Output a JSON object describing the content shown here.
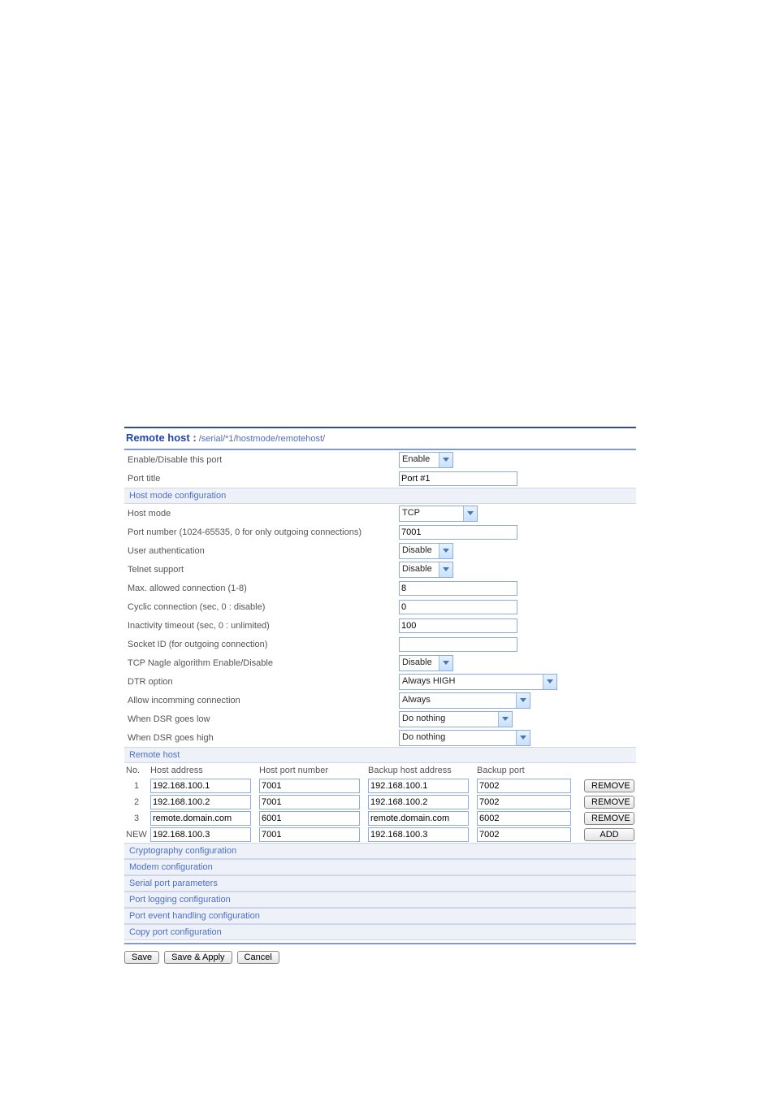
{
  "title": "Remote host :",
  "path_prefix": " /",
  "path_parts": [
    "serial",
    "*1",
    "hostmode",
    "remotehost"
  ],
  "path_suffix": "/",
  "rows": {
    "enable_lbl": "Enable/Disable this port",
    "enable_val": "Enable",
    "porttitle_lbl": "Port title",
    "porttitle_val": "Port #1"
  },
  "sec1": "Host mode configuration",
  "hm": {
    "hostmode_lbl": "Host mode",
    "hostmode_val": "TCP",
    "portnum_lbl": "Port number (1024-65535, 0 for only outgoing connections)",
    "portnum_val": "7001",
    "userauth_lbl": "User authentication",
    "userauth_val": "Disable",
    "telnet_lbl": "Telnet support",
    "telnet_val": "Disable",
    "maxconn_lbl": "Max. allowed connection (1-8)",
    "maxconn_val": "8",
    "cyclic_lbl": "Cyclic connection (sec, 0 : disable)",
    "cyclic_val": "0",
    "inact_lbl": "Inactivity timeout (sec, 0 : unlimited)",
    "inact_val": "100",
    "sockid_lbl": "Socket ID (for outgoing connection)",
    "sockid_val": "",
    "nagle_lbl": "TCP Nagle algorithm Enable/Disable",
    "nagle_val": "Disable",
    "dtr_lbl": "DTR option",
    "dtr_val": "Always HIGH",
    "allowin_lbl": "Allow incomming connection",
    "allowin_val": "Always",
    "dsrlow_lbl": "When DSR goes low",
    "dsrlow_val": "Do nothing",
    "dsrhigh_lbl": "When DSR goes high",
    "dsrhigh_val": "Do nothing"
  },
  "sec2": "Remote host",
  "tbl": {
    "h_no": "No.",
    "h_host": "Host address",
    "h_port": "Host port number",
    "h_bhost": "Backup host address",
    "h_bport": "Backup port",
    "rows": [
      {
        "no": "1",
        "host": "192.168.100.1",
        "port": "7001",
        "bhost": "192.168.100.1",
        "bport": "7002",
        "btn": "REMOVE"
      },
      {
        "no": "2",
        "host": "192.168.100.2",
        "port": "7001",
        "bhost": "192.168.100.2",
        "bport": "7002",
        "btn": "REMOVE"
      },
      {
        "no": "3",
        "host": "remote.domain.com",
        "port": "6001",
        "bhost": "remote.domain.com",
        "bport": "6002",
        "btn": "REMOVE"
      }
    ],
    "new_lbl": "NEW",
    "new": {
      "host": "192.168.100.3",
      "port": "7001",
      "bhost": "192.168.100.3",
      "bport": "7002",
      "btn": "ADD"
    }
  },
  "links": [
    "Cryptography configuration",
    "Modem configuration",
    "Serial port parameters",
    "Port logging configuration",
    "Port event handling configuration",
    "Copy port configuration"
  ],
  "buttons": {
    "save": "Save",
    "saveapply": "Save & Apply",
    "cancel": "Cancel"
  }
}
